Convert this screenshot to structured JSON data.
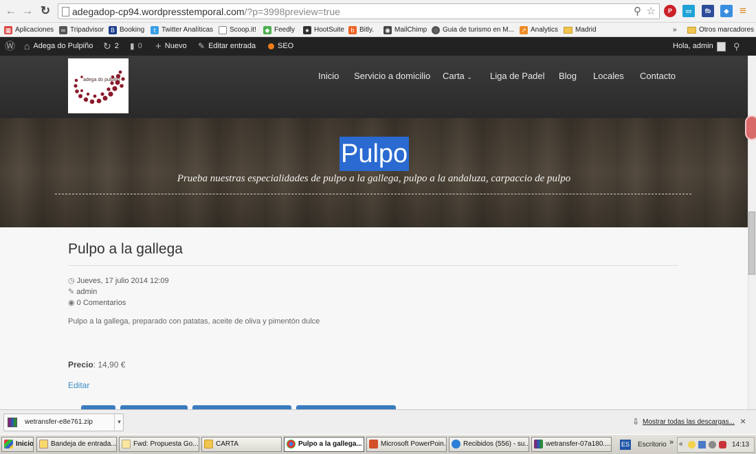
{
  "browser": {
    "url_host": "adegadop-cp94.wordpresstemporal.com",
    "url_rest": "/?p=3998preview=true"
  },
  "bookmarks": [
    {
      "label": "Aplicaciones",
      "icon": "apps-grid-icon",
      "color": "#d44"
    },
    {
      "label": "Tripadvisor",
      "icon": "tripadvisor-owl-icon",
      "color": "#555"
    },
    {
      "label": "Booking",
      "icon": "booking-b-icon",
      "color": "#1a3b8c"
    },
    {
      "label": "Twitter Analíticas",
      "icon": "twitter-bird-icon",
      "color": "#3a9ee5"
    },
    {
      "label": "Scoop.it!",
      "icon": "page-icon",
      "color": "#ffffff"
    },
    {
      "label": "Feedly",
      "icon": "feedly-icon",
      "color": "#4caf50"
    },
    {
      "label": "HootSuite",
      "icon": "hootsuite-owl-icon",
      "color": "#333"
    },
    {
      "label": "Bitly.",
      "icon": "bitly-icon",
      "color": "#ee6123"
    },
    {
      "label": "MailChimp",
      "icon": "mailchimp-icon",
      "color": "#444"
    },
    {
      "label": "Guia de turismo en M...",
      "icon": "circle-icon",
      "color": "#555"
    },
    {
      "label": "Analytics",
      "icon": "analytics-icon",
      "color": "#f08a24"
    },
    {
      "label": "Madrid",
      "icon": "folder-icon",
      "color": "#f0c550"
    }
  ],
  "bookmarks_overflow": "»",
  "bookmarks_other": "Otros marcadores",
  "adminbar": {
    "site": "Adega do Pulpiño",
    "updates": "2",
    "comments": "0",
    "new": "Nuevo",
    "edit": "Editar entrada",
    "seo": "SEO",
    "greeting": "Hola, admin"
  },
  "nav": [
    "Inicio",
    "Servicio a domicilio",
    "Carta",
    "Liga de Padel",
    "Blog",
    "Locales",
    "Contacto"
  ],
  "logo_text": "adega do pulpiño",
  "banner": {
    "title": "Pulpo",
    "subtitle": "Prueba nuestras especialidades de pulpo a la gallega, pulpo a la andaluza, carpaccio de pulpo"
  },
  "post": {
    "title": "Pulpo a la gallega",
    "date": "Jueves, 17 julio 2014 12:09",
    "author": "admin",
    "comments": "0 Comentarios",
    "description": "Pulpo a la gallega, preparado con patatas, aceite de oliva y pimentón dulce",
    "price_label": "Precio",
    "price_value": ": 14,90 €",
    "edit": "Editar"
  },
  "downloads": {
    "file": "wetransfer-e8e761.zip",
    "show_all": "Mostrar todas las descargas...",
    "close": "×"
  },
  "taskbar": {
    "start": "Inicio",
    "items": [
      {
        "label": "Bandeja de entrada...",
        "active": false
      },
      {
        "label": "Fwd: Propuesta Go...",
        "active": false
      },
      {
        "label": "CARTA",
        "active": false
      },
      {
        "label": "Pulpo a la gallega...",
        "active": true
      },
      {
        "label": "Microsoft PowerPoin...",
        "active": false
      },
      {
        "label": "Recibidos (556) - su...",
        "active": false
      },
      {
        "label": "wetransfer-07a180....",
        "active": false
      }
    ],
    "lang": "ES",
    "desktop": "Escritorio",
    "clock": "14:13"
  }
}
